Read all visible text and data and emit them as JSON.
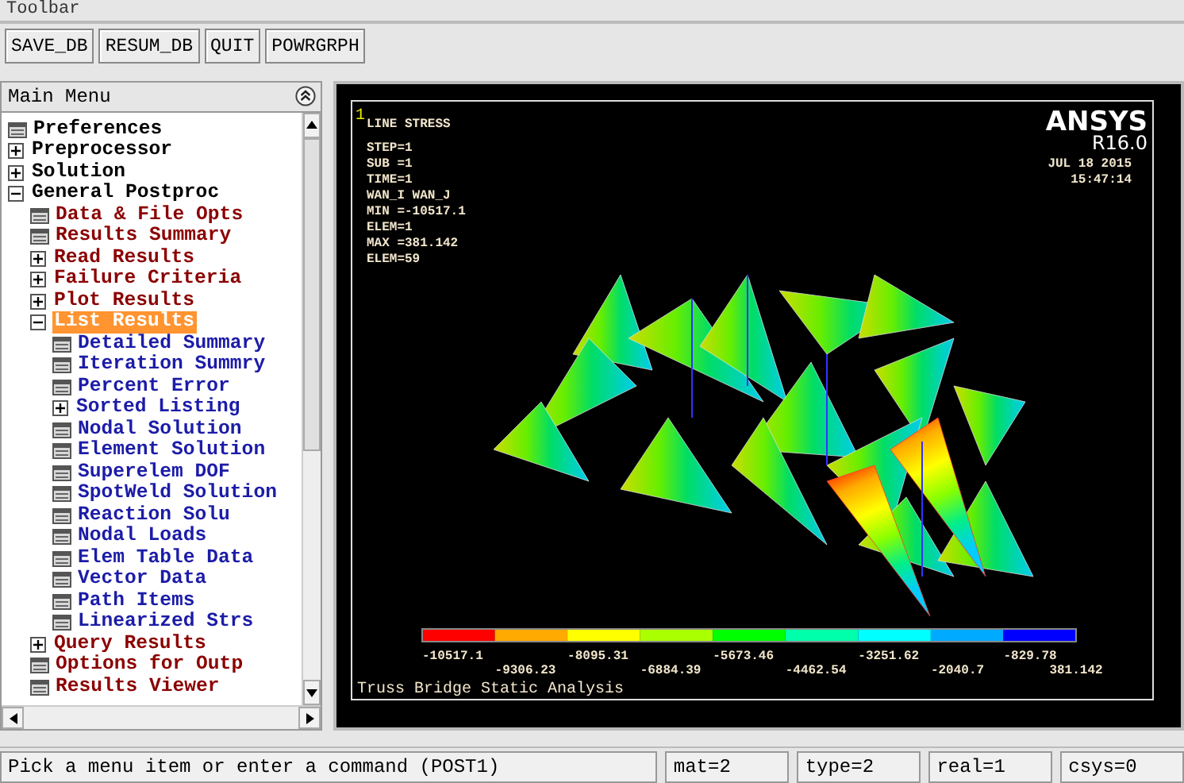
{
  "toolbar": {
    "title": "Toolbar",
    "buttons": [
      "SAVE_DB",
      "RESUM_DB",
      "QUIT",
      "POWRGRPH"
    ]
  },
  "main_menu": {
    "title": "Main Menu",
    "items": [
      {
        "label": "Preferences",
        "kind": "leaf",
        "selected": false
      },
      {
        "label": "Preprocessor",
        "kind": "branch",
        "expanded": false,
        "selected": false
      },
      {
        "label": "Solution",
        "kind": "branch",
        "expanded": false,
        "selected": false
      },
      {
        "label": "General Postproc",
        "kind": "branch",
        "expanded": true,
        "selected": false,
        "children": [
          {
            "label": "Data & File Opts",
            "kind": "leaf",
            "selected": false
          },
          {
            "label": "Results Summary",
            "kind": "leaf",
            "selected": false
          },
          {
            "label": "Read Results",
            "kind": "branch",
            "expanded": false,
            "selected": false
          },
          {
            "label": "Failure Criteria",
            "kind": "branch",
            "expanded": false,
            "selected": false
          },
          {
            "label": "Plot Results",
            "kind": "branch",
            "expanded": false,
            "selected": false
          },
          {
            "label": "List Results",
            "kind": "branch",
            "expanded": true,
            "selected": true,
            "children": [
              {
                "label": "Detailed Summary",
                "kind": "leaf",
                "selected": false
              },
              {
                "label": "Iteration Summry",
                "kind": "leaf",
                "selected": false
              },
              {
                "label": "Percent Error",
                "kind": "leaf",
                "selected": false
              },
              {
                "label": "Sorted Listing",
                "kind": "branch",
                "expanded": false,
                "selected": false
              },
              {
                "label": "Nodal Solution",
                "kind": "leaf",
                "selected": false
              },
              {
                "label": "Element Solution",
                "kind": "leaf",
                "selected": false
              },
              {
                "label": "Superelem DOF",
                "kind": "leaf",
                "selected": false
              },
              {
                "label": "SpotWeld Solution",
                "kind": "leaf",
                "selected": false
              },
              {
                "label": "Reaction Solu",
                "kind": "leaf",
                "selected": false
              },
              {
                "label": "Nodal Loads",
                "kind": "leaf",
                "selected": false
              },
              {
                "label": "Elem Table Data",
                "kind": "leaf",
                "selected": false
              },
              {
                "label": "Vector Data",
                "kind": "leaf",
                "selected": false
              },
              {
                "label": "Path Items",
                "kind": "leaf",
                "selected": false
              },
              {
                "label": "Linearized Strs",
                "kind": "leaf",
                "selected": false
              }
            ]
          },
          {
            "label": "Query Results",
            "kind": "branch",
            "expanded": false,
            "selected": false
          },
          {
            "label": "Options for Outp",
            "kind": "leaf",
            "selected": false
          },
          {
            "label": "Results Viewer",
            "kind": "leaf",
            "selected": false
          }
        ]
      }
    ]
  },
  "graphics": {
    "window_number": "1",
    "plot_title": "LINE STRESS",
    "info_lines": [
      "STEP=1",
      "SUB =1",
      "TIME=1",
      "WAN_I   WAN_J",
      "MIN =-10517.1",
      "ELEM=1",
      "MAX =381.142",
      "ELEM=59"
    ],
    "logo": "ANSYS",
    "version": "R16.0",
    "date": "JUL 18 2015",
    "time": "15:47:14",
    "legend": {
      "bands": [
        {
          "color": "#ff0000"
        },
        {
          "color": "#ffaa00"
        },
        {
          "color": "#ffff00"
        },
        {
          "color": "#aaff00"
        },
        {
          "color": "#00ff00"
        },
        {
          "color": "#00ffaa"
        },
        {
          "color": "#00ffff"
        },
        {
          "color": "#00aaff"
        },
        {
          "color": "#0000ff"
        }
      ],
      "labels": [
        "-10517.1",
        "-9306.23",
        "-8095.31",
        "-6884.39",
        "-5673.46",
        "-4462.54",
        "-3251.62",
        "-2040.7",
        "-829.78",
        "381.142"
      ]
    },
    "caption": "Truss Bridge Static Analysis"
  },
  "status_bar": {
    "prompt": "Pick a menu item or enter a command (POST1)",
    "fields": [
      "mat=2",
      "type=2",
      "real=1",
      "csys=0"
    ]
  }
}
